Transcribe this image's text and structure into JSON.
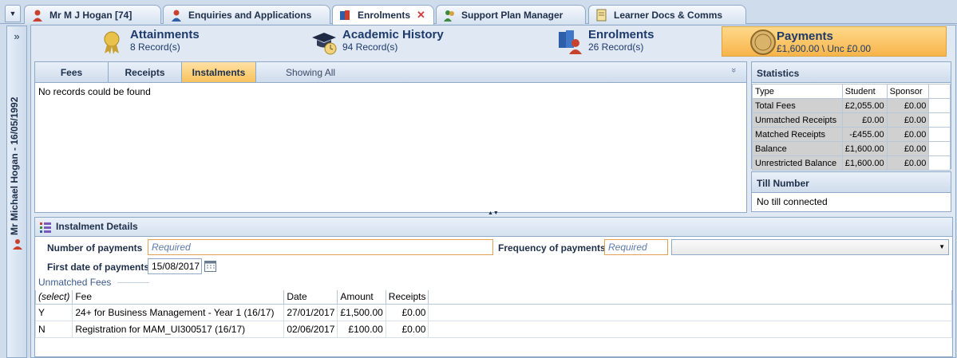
{
  "tabs": [
    {
      "label": "Mr M J Hogan [74]",
      "icon": "person-icon"
    },
    {
      "label": "Enquiries and Applications",
      "icon": "person-icon"
    },
    {
      "label": "Enrolments",
      "icon": "books-icon",
      "active": true,
      "closable": true,
      "close_glyph": "✕"
    },
    {
      "label": "Support Plan Manager",
      "icon": "person-group-icon"
    },
    {
      "label": "Learner Docs & Comms",
      "icon": "docs-icon"
    }
  ],
  "tab_menu_glyph": "▼",
  "side": {
    "expand_glyph": "»",
    "learner_label": "Mr Michael Hogan - 16/05/1992"
  },
  "summary": {
    "attainments": {
      "title": "Attainments",
      "sub": "8 Record(s)"
    },
    "academic_history": {
      "title": "Academic History",
      "sub": "94 Record(s)"
    },
    "enrolments": {
      "title": "Enrolments",
      "sub": "26 Record(s)"
    },
    "payments": {
      "title": "Payments",
      "sub": "£1,600.00 \\ Unc £0.00"
    }
  },
  "fees_tabs": [
    "Fees",
    "Receipts",
    "Instalments"
  ],
  "fees_active_tab": "Instalments",
  "showing": "Showing All",
  "collapse_glyph": "»",
  "no_records": "No records could be found",
  "statistics": {
    "title": "Statistics",
    "columns": [
      "Type",
      "Student",
      "Sponsor"
    ],
    "rows": [
      [
        "Total Fees",
        "£2,055.00",
        "£0.00"
      ],
      [
        "Unmatched Receipts",
        "£0.00",
        "£0.00"
      ],
      [
        "Matched Receipts",
        "-£455.00",
        "£0.00"
      ],
      [
        "Balance",
        "£1,600.00",
        "£0.00"
      ],
      [
        "Unrestricted Balance",
        "£1,600.00",
        "£0.00"
      ]
    ]
  },
  "till": {
    "title": "Till Number",
    "value": "No till connected"
  },
  "splitter_glyph": "▲▼",
  "instalment": {
    "title": "Instalment Details",
    "num_payments_label": "Number of payments",
    "num_payments_placeholder": "Required",
    "frequency_label": "Frequency of payments",
    "frequency_placeholder": "Required",
    "frequency_dropdown_glyph": "▼",
    "first_date_label": "First date of payments",
    "first_date_value": "15/08/2017",
    "unmatched_label": "Unmatched Fees",
    "columns": [
      "(select)",
      "Fee",
      "Date",
      "Amount",
      "Receipts"
    ],
    "rows": [
      [
        "Y",
        "24+ for Business Management - Year 1 (16/17)",
        "27/01/2017",
        "£1,500.00",
        "£0.00"
      ],
      [
        "N",
        "Registration for MAM_UI300517 (16/17)",
        "02/06/2017",
        "£100.00",
        "£0.00"
      ]
    ]
  },
  "colors": {
    "accent_orange": "#f7b54a",
    "header_blue": "#1e3a6b",
    "frame_blue": "#8fa9c9"
  }
}
